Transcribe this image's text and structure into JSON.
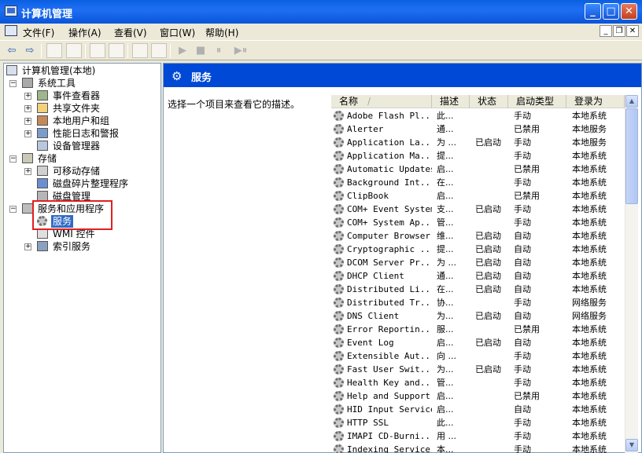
{
  "window": {
    "title": "计算机管理",
    "min": "_",
    "max": "□",
    "close": "✕"
  },
  "menu": [
    {
      "label": "文件(F)"
    },
    {
      "label": "操作(A)"
    },
    {
      "label": "查看(V)"
    },
    {
      "label": "窗口(W)"
    },
    {
      "label": "帮助(H)"
    }
  ],
  "mdi": {
    "min": "_",
    "restore": "❐",
    "close": "✕"
  },
  "toolbar": {
    "back": "⇦",
    "forward": "⇨",
    "play": "▶",
    "stop": "■",
    "pause": "⏸",
    "restart": "▶⏸"
  },
  "tree": [
    {
      "label": "计算机管理(本地)"
    },
    {
      "label": "系统工具",
      "exp": "−"
    },
    {
      "label": "事件查看器",
      "exp": "+"
    },
    {
      "label": "共享文件夹",
      "exp": "+"
    },
    {
      "label": "本地用户和组",
      "exp": "+"
    },
    {
      "label": "性能日志和警报",
      "exp": "+"
    },
    {
      "label": "设备管理器"
    },
    {
      "label": "存储",
      "exp": "−"
    },
    {
      "label": "可移动存储",
      "exp": "+"
    },
    {
      "label": "磁盘碎片整理程序"
    },
    {
      "label": "磁盘管理"
    },
    {
      "label": "服务和应用程序",
      "exp": "−"
    },
    {
      "label": "服务"
    },
    {
      "label": "WMI 控件"
    },
    {
      "label": "索引服务",
      "exp": "+"
    }
  ],
  "panel": {
    "title": "服务",
    "description": "选择一个项目来查看它的描述。"
  },
  "columns": [
    "名称",
    "描述",
    "状态",
    "启动类型",
    "登录为"
  ],
  "sort_indicator": "/",
  "rows": [
    {
      "name": "Adobe Flash Pl...",
      "desc": "此...",
      "status": "",
      "start": "手动",
      "logon": "本地系统"
    },
    {
      "name": "Alerter",
      "desc": "通...",
      "status": "",
      "start": "已禁用",
      "logon": "本地服务"
    },
    {
      "name": "Application La...",
      "desc": "为 ...",
      "status": "已启动",
      "start": "手动",
      "logon": "本地服务"
    },
    {
      "name": "Application Ma...",
      "desc": "提...",
      "status": "",
      "start": "手动",
      "logon": "本地系统"
    },
    {
      "name": "Automatic Updates",
      "desc": "启...",
      "status": "",
      "start": "已禁用",
      "logon": "本地系统"
    },
    {
      "name": "Background Int...",
      "desc": "在...",
      "status": "",
      "start": "手动",
      "logon": "本地系统"
    },
    {
      "name": "ClipBook",
      "desc": "启...",
      "status": "",
      "start": "已禁用",
      "logon": "本地系统"
    },
    {
      "name": "COM+ Event System",
      "desc": "支...",
      "status": "已启动",
      "start": "手动",
      "logon": "本地系统"
    },
    {
      "name": "COM+ System Ap...",
      "desc": "管...",
      "status": "",
      "start": "手动",
      "logon": "本地系统"
    },
    {
      "name": "Computer Browser",
      "desc": "维...",
      "status": "已启动",
      "start": "自动",
      "logon": "本地系统"
    },
    {
      "name": "Cryptographic ...",
      "desc": "提...",
      "status": "已启动",
      "start": "自动",
      "logon": "本地系统"
    },
    {
      "name": "DCOM Server Pr...",
      "desc": "为 ...",
      "status": "已启动",
      "start": "自动",
      "logon": "本地系统"
    },
    {
      "name": "DHCP Client",
      "desc": "通...",
      "status": "已启动",
      "start": "自动",
      "logon": "本地系统"
    },
    {
      "name": "Distributed Li...",
      "desc": "在...",
      "status": "已启动",
      "start": "自动",
      "logon": "本地系统"
    },
    {
      "name": "Distributed Tr...",
      "desc": "协...",
      "status": "",
      "start": "手动",
      "logon": "网络服务"
    },
    {
      "name": "DNS Client",
      "desc": "为...",
      "status": "已启动",
      "start": "自动",
      "logon": "网络服务"
    },
    {
      "name": "Error Reportin...",
      "desc": "服...",
      "status": "",
      "start": "已禁用",
      "logon": "本地系统"
    },
    {
      "name": "Event Log",
      "desc": "启...",
      "status": "已启动",
      "start": "自动",
      "logon": "本地系统"
    },
    {
      "name": "Extensible Aut...",
      "desc": "向 ...",
      "status": "",
      "start": "手动",
      "logon": "本地系统"
    },
    {
      "name": "Fast User Swit...",
      "desc": "为...",
      "status": "已启动",
      "start": "手动",
      "logon": "本地系统"
    },
    {
      "name": "Health Key and...",
      "desc": "管...",
      "status": "",
      "start": "手动",
      "logon": "本地系统"
    },
    {
      "name": "Help and Support",
      "desc": "启...",
      "status": "",
      "start": "已禁用",
      "logon": "本地系统"
    },
    {
      "name": "HID Input Service",
      "desc": "启...",
      "status": "",
      "start": "自动",
      "logon": "本地系统"
    },
    {
      "name": "HTTP SSL",
      "desc": "此...",
      "status": "",
      "start": "手动",
      "logon": "本地系统"
    },
    {
      "name": "IMAPI CD-Burni...",
      "desc": "用 ...",
      "status": "",
      "start": "手动",
      "logon": "本地系统"
    },
    {
      "name": "Indexing Service",
      "desc": "本...",
      "status": "",
      "start": "手动",
      "logon": "本地系统"
    }
  ]
}
